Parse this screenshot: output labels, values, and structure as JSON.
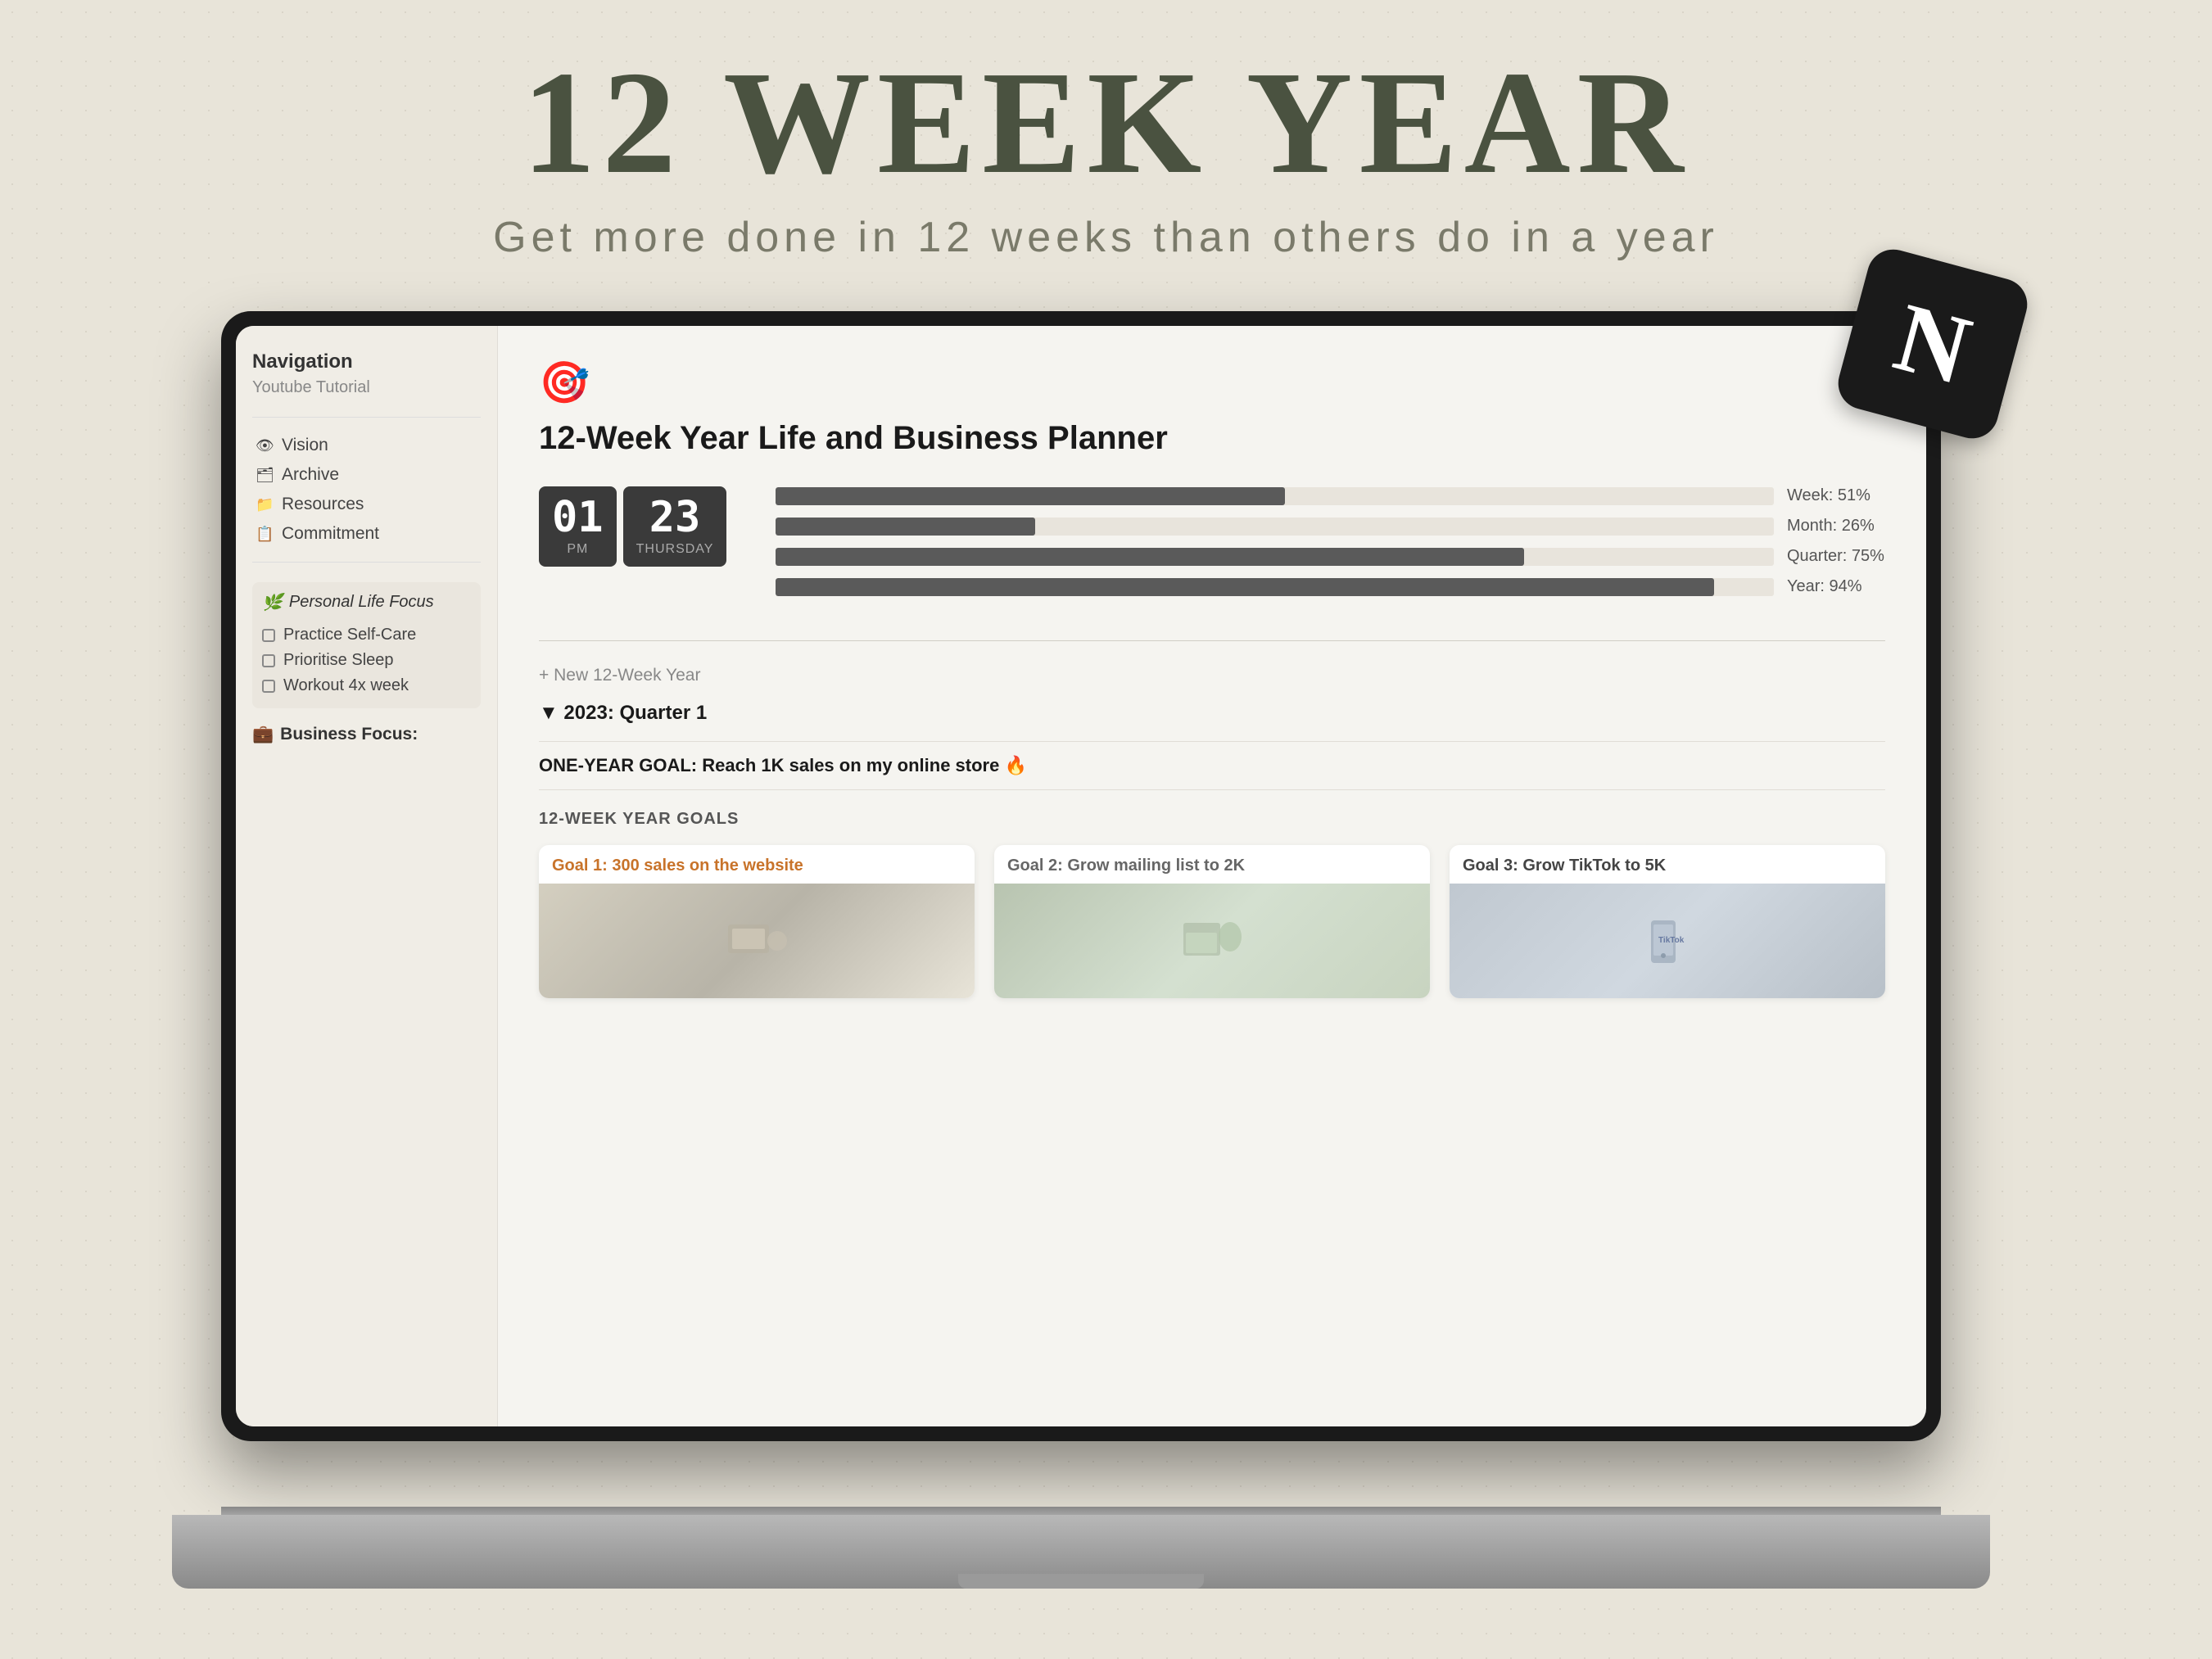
{
  "page": {
    "main_title": "12 WEEK YEAR",
    "subtitle": "Get more done in 12 weeks than others do in a year"
  },
  "notion": {
    "badge_letter": "N"
  },
  "app": {
    "icon": "🎯",
    "title": "12-Week Year  Life and Business Planner",
    "time": {
      "hour": "01",
      "minute": "23",
      "am_pm": "PM",
      "day": "THURSDAY"
    },
    "progress": [
      {
        "label": "Week: 51%",
        "percent": 51
      },
      {
        "label": "Month: 26%",
        "percent": 26
      },
      {
        "label": "Quarter: 75%",
        "percent": 75
      },
      {
        "label": "Year: 94%",
        "percent": 94
      }
    ],
    "sidebar": {
      "nav_title": "Navigation",
      "nav_tutorial": "Youtube Tutorial",
      "nav_items": [
        {
          "icon": "👁",
          "label": "Vision"
        },
        {
          "icon": "🗂",
          "label": "Archive"
        },
        {
          "icon": "📁",
          "label": "Resources"
        },
        {
          "icon": "📋",
          "label": "Commitment"
        }
      ],
      "personal_focus": {
        "title": "Personal Life Focus",
        "icon": "🌿",
        "items": [
          "Practice Self-Care",
          "Prioritise Sleep",
          "Workout 4x week"
        ]
      },
      "business_focus": {
        "title": "Business Focus:",
        "icon": "💼"
      }
    },
    "main": {
      "new_link": "+ New 12-Week Year",
      "quarter_header": "▼ 2023: Quarter 1",
      "one_year_goal": "ONE-YEAR GOAL: Reach 1K sales on my online store 🔥",
      "goals_section_title": "12-WEEK YEAR GOALS",
      "goals": [
        {
          "title": "Goal 1: 300 sales on the website",
          "title_class": "goal-1-title",
          "img_class": "goal-img-1"
        },
        {
          "title": "Goal 2: Grow mailing list to 2K",
          "title_class": "goal-2-title",
          "img_class": "goal-img-2"
        },
        {
          "title": "Goal 3: Grow TikTok to 5K",
          "title_class": "goal-3-title",
          "img_class": "goal-img-3"
        }
      ]
    }
  }
}
